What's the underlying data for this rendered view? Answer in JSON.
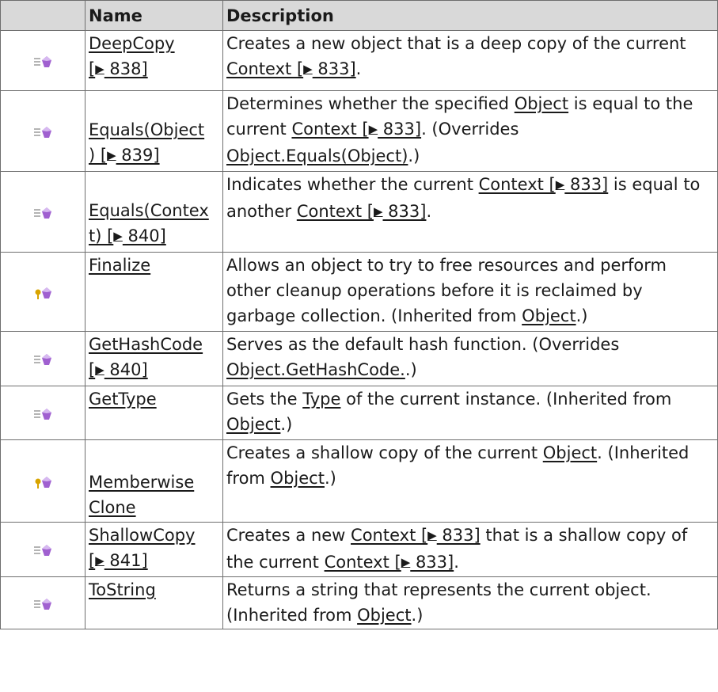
{
  "headers": {
    "icon": "",
    "name": "Name",
    "description": "Description"
  },
  "rows": [
    {
      "icon": "public-method-icon",
      "name_parts": [
        [
          "DeepCopy",
          "link"
        ],
        [
          "\n",
          "br"
        ],
        [
          "[",
          "link"
        ],
        [
          "▶",
          "arrow"
        ],
        [
          " 838]",
          "link"
        ]
      ],
      "desc": [
        [
          "Creates a new object that is a deep copy of the current ",
          "text"
        ],
        [
          "Context [",
          "link"
        ],
        [
          "▶",
          "arrow"
        ],
        [
          " 833]",
          "link"
        ],
        [
          ".",
          "text"
        ]
      ]
    },
    {
      "icon": "public-method-icon",
      "name_parts": [
        [
          "Equals(Object",
          "link"
        ],
        [
          "\n",
          "br"
        ],
        [
          ") [",
          "link"
        ],
        [
          "▶",
          "arrow"
        ],
        [
          " 839]",
          "link"
        ]
      ],
      "desc": [
        [
          "Determines whether the specified ",
          "text"
        ],
        [
          "Object",
          "link"
        ],
        [
          " is equal to the current ",
          "text"
        ],
        [
          "Context [",
          "link"
        ],
        [
          "▶",
          "arrow"
        ],
        [
          " 833]",
          "link"
        ],
        [
          ". (Overrides ",
          "text"
        ],
        [
          "Object.Equals(Object)",
          "link"
        ],
        [
          ".)",
          "text"
        ]
      ]
    },
    {
      "icon": "public-method-icon",
      "name_parts": [
        [
          "Equals(Contex",
          "link"
        ],
        [
          "\n",
          "br"
        ],
        [
          "t) [",
          "link"
        ],
        [
          "▶",
          "arrow"
        ],
        [
          " 840]",
          "link"
        ]
      ],
      "desc": [
        [
          "Indicates whether the current ",
          "text"
        ],
        [
          "Context [",
          "link"
        ],
        [
          "▶",
          "arrow"
        ],
        [
          " 833]",
          "link"
        ],
        [
          " is equal to another ",
          "text"
        ],
        [
          "Context [",
          "link"
        ],
        [
          "▶",
          "arrow"
        ],
        [
          " 833]",
          "link"
        ],
        [
          ".",
          "text"
        ]
      ]
    },
    {
      "icon": "protected-method-icon",
      "name_parts": [
        [
          "Finalize",
          "link"
        ]
      ],
      "desc": [
        [
          "Allows an object to try to free resources and perform other cleanup operations before it is reclaimed by garbage collection. (Inherited from ",
          "text"
        ],
        [
          "Object",
          "link"
        ],
        [
          ".)",
          "text"
        ]
      ]
    },
    {
      "icon": "public-method-icon",
      "name_parts": [
        [
          "GetHashCode",
          "link"
        ],
        [
          "\n",
          "br"
        ],
        [
          "[",
          "link"
        ],
        [
          "▶",
          "arrow"
        ],
        [
          " 840]",
          "link"
        ]
      ],
      "desc": [
        [
          "Serves as the default hash function. (Overrides ",
          "text"
        ],
        [
          "Object.GetHashCode.",
          "link"
        ],
        [
          ".)",
          "text"
        ]
      ]
    },
    {
      "icon": "public-method-icon",
      "name_parts": [
        [
          "GetType",
          "link"
        ]
      ],
      "desc": [
        [
          "Gets the ",
          "text"
        ],
        [
          "Type",
          "link"
        ],
        [
          " of the current instance. (Inherited from ",
          "text"
        ],
        [
          "Object",
          "link"
        ],
        [
          ".)",
          "text"
        ]
      ]
    },
    {
      "icon": "protected-method-icon",
      "name_parts": [
        [
          "Memberwise",
          "link"
        ],
        [
          "\n",
          "br"
        ],
        [
          "Clone",
          "link"
        ]
      ],
      "desc": [
        [
          "Creates a shallow copy of the current ",
          "text"
        ],
        [
          "Object",
          "link"
        ],
        [
          ". (Inherited from ",
          "text"
        ],
        [
          "Object",
          "link"
        ],
        [
          ".)",
          "text"
        ]
      ]
    },
    {
      "icon": "public-method-icon",
      "name_parts": [
        [
          "ShallowCopy",
          "link"
        ],
        [
          "\n",
          "br"
        ],
        [
          "[",
          "link"
        ],
        [
          "▶",
          "arrow"
        ],
        [
          " 841]",
          "link"
        ]
      ],
      "desc": [
        [
          "Creates a new ",
          "text"
        ],
        [
          "Context [",
          "link"
        ],
        [
          "▶",
          "arrow"
        ],
        [
          " 833]",
          "link"
        ],
        [
          " that is a shallow copy of the current ",
          "text"
        ],
        [
          "Context [",
          "link"
        ],
        [
          "▶",
          "arrow"
        ],
        [
          " 833]",
          "link"
        ],
        [
          ".",
          "text"
        ]
      ]
    },
    {
      "icon": "public-method-icon",
      "name_parts": [
        [
          "ToString",
          "link"
        ]
      ],
      "desc": [
        [
          "Returns a string that represents the current object. (Inherited from ",
          "text"
        ],
        [
          "Object",
          "link"
        ],
        [
          ".)",
          "text"
        ]
      ]
    }
  ],
  "colors": {
    "header_bg": "#d9d9d9",
    "border": "#6e6e6e",
    "icon_purple": "#a060d0",
    "icon_key": "#d8a400",
    "icon_lines": "#9a9a9a"
  }
}
